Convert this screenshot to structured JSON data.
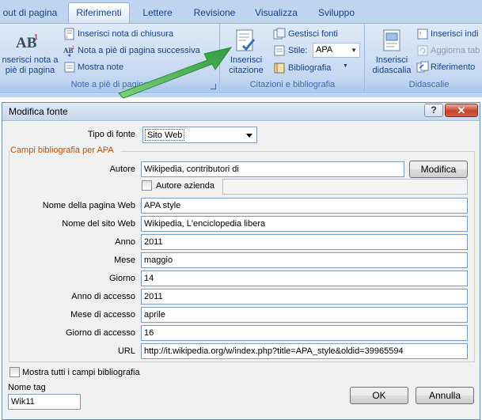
{
  "ribbon": {
    "tabs": [
      "out di pagina",
      "Riferimenti",
      "Lettere",
      "Revisione",
      "Visualizza",
      "Sviluppo"
    ],
    "active_tab": "Riferimenti",
    "footnotes_group": {
      "big_button_line1": "nserisci nota a",
      "big_button_line2": "piè di pagina",
      "insert_endnote": "Inserisci nota di chiusura",
      "next_footnote": "Nota a piè di pagina successiva",
      "show_notes": "Mostra note",
      "label": "Note a piè di pagina"
    },
    "citations_group": {
      "big_button_line1": "Inserisci",
      "big_button_line2": "citazione",
      "manage_sources": "Gestisci fonti",
      "style_label": "Stile:",
      "style_value": "APA",
      "bibliography": "Bibliografia",
      "label": "Citazioni e bibliografia"
    },
    "captions_group": {
      "big_button_line1": "Inserisci",
      "big_button_line2": "didascalia",
      "insert_index": "Inserisci indi",
      "update_table": "Aggiorna tab",
      "cross_reference": "Riferimento",
      "label": "Didascalie"
    }
  },
  "dialog": {
    "title": "Modifica fonte",
    "help_glyph": "?",
    "close_glyph": "✕",
    "source_type_label": "Tipo di fonte",
    "source_type_value": "Sito Web",
    "section_title": "Campi bibliografia per APA",
    "author_label": "Autore",
    "author_value": "Wikipedia, contributori di",
    "edit_button": "Modifica",
    "corporate_author_label": "Autore azienda",
    "corporate_author_value": "",
    "fields": [
      {
        "label": "Nome della pagina Web",
        "value": "APA style"
      },
      {
        "label": "Nome del sito Web",
        "value": "Wikipedia, L'enciclopedia libera"
      },
      {
        "label": "Anno",
        "value": "2011"
      },
      {
        "label": "Mese",
        "value": "maggio"
      },
      {
        "label": "Giorno",
        "value": "14"
      },
      {
        "label": "Anno di accesso",
        "value": "2011"
      },
      {
        "label": "Mese di accesso",
        "value": "aprile"
      },
      {
        "label": "Giorno di accesso",
        "value": "16"
      },
      {
        "label": "URL",
        "value": "http://it.wikipedia.org/w/index.php?title=APA_style&oldid=39965594"
      }
    ],
    "show_all_fields_label": "Mostra tutti i campi bibliografia",
    "tag_name_label": "Nome tag",
    "tag_name_value": "Wik11",
    "ok_button": "OK",
    "cancel_button": "Annulla"
  },
  "colors": {
    "ribbon_bg": "#bfd4ee",
    "ribbon_text": "#15428b",
    "section_title": "#c05000",
    "arrow_green": "#3ca84a"
  }
}
